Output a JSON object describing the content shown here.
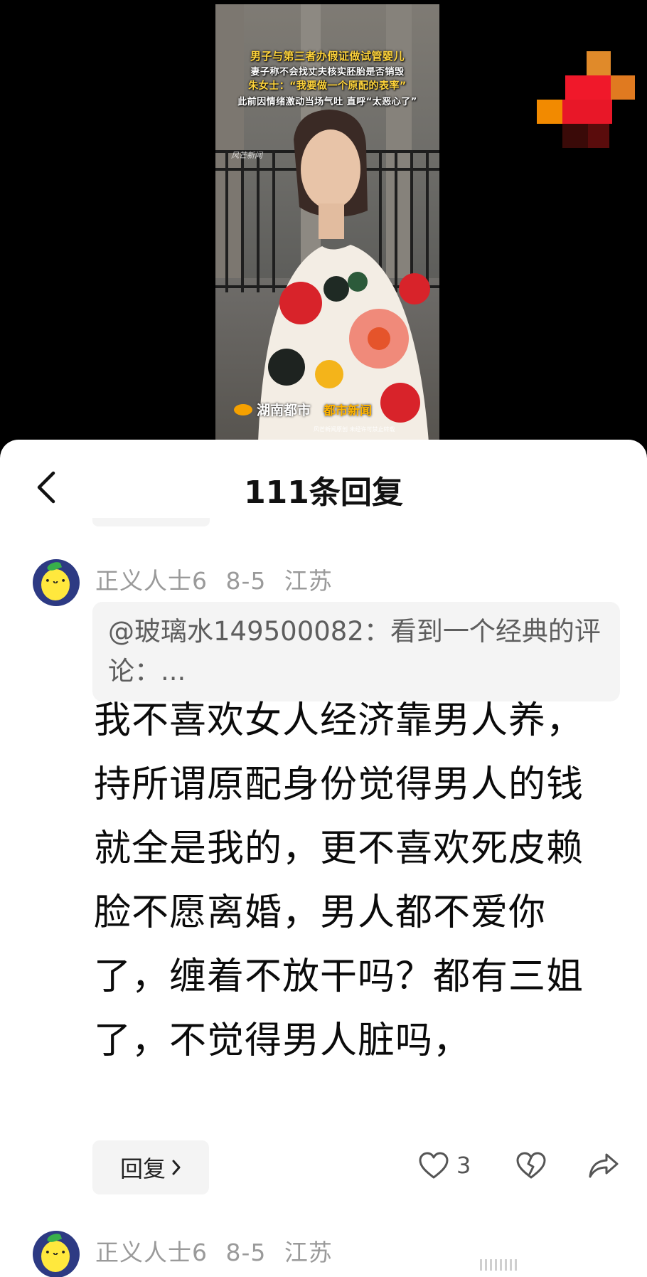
{
  "video": {
    "captions": [
      "男子与第三者办假证做试管婴儿",
      "妻子称不会找丈夫核实胚胎是否销毁",
      "朱女士：“我要做一个原配的表率”",
      "此前因情绪激动当场气吐 直呼“太恶心了”"
    ],
    "watermark_top": "风芒新闻",
    "logo_name": "湖南都市",
    "logo_name2": "都市新闻",
    "copyright": "风芒新闻原创 未经许可禁止转载"
  },
  "sheet": {
    "title": "111条回复",
    "back_icon": "chevron-left-icon"
  },
  "comments": [
    {
      "author": "正义人士6",
      "date": "8-5",
      "location": "江苏",
      "quote": "@玻璃水149500082：看到一个经典的评论：...",
      "text": "我不喜欢女人经济靠男人养，持所谓原配身份觉得男人的钱就全是我的，更不喜欢死皮赖脸不愿离婚，男人都不爱你了，缠着不放干吗？都有三姐了，不觉得男人脏吗，",
      "reply_label": "回复",
      "likes": "3"
    },
    {
      "author": "正义人士6",
      "date": "8-5",
      "location": "江苏"
    }
  ],
  "colors": {
    "caption_yellow": "#ffd43b",
    "meta_gray": "#9a9a9a",
    "box_bg": "#f4f4f4"
  }
}
